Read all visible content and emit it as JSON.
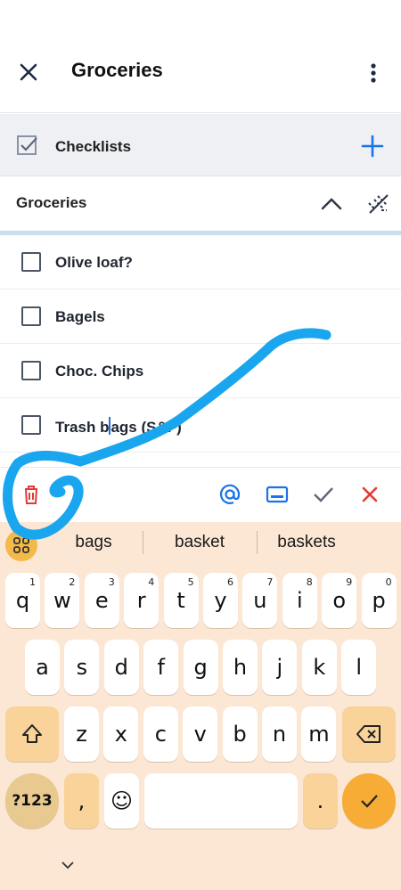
{
  "appbar": {
    "title": "Groceries",
    "close_icon": "close-icon",
    "more_icon": "more-vert-icon"
  },
  "section": {
    "label": "Checklists",
    "icon": "checkbox-checked-icon",
    "add_icon": "plus-icon"
  },
  "list": {
    "name": "Groceries",
    "collapse_icon": "chevron-up-icon",
    "sync_icon": "sync-off-icon",
    "items": [
      {
        "text": "Olive loaf?",
        "checked": false
      },
      {
        "text": "Bagels",
        "checked": false
      },
      {
        "text": "Choc. Chips",
        "checked": false
      },
      {
        "text_before_cursor": "Trash b",
        "text_after_cursor": "ags (S&F)",
        "checked": false
      }
    ]
  },
  "toolbar": {
    "delete_icon": "trash-icon",
    "mention_icon": "at-icon",
    "keyboard_icon": "keyboard-icon",
    "confirm_icon": "check-icon",
    "cancel_icon": "close-icon"
  },
  "keyboard": {
    "suggestions": [
      "bags",
      "basket",
      "baskets"
    ],
    "row1": [
      {
        "k": "q",
        "h": "1"
      },
      {
        "k": "w",
        "h": "2"
      },
      {
        "k": "e",
        "h": "3"
      },
      {
        "k": "r",
        "h": "4"
      },
      {
        "k": "t",
        "h": "5"
      },
      {
        "k": "y",
        "h": "6"
      },
      {
        "k": "u",
        "h": "7"
      },
      {
        "k": "i",
        "h": "8"
      },
      {
        "k": "o",
        "h": "9"
      },
      {
        "k": "p",
        "h": "0"
      }
    ],
    "row2": [
      "a",
      "s",
      "d",
      "f",
      "g",
      "h",
      "j",
      "k",
      "l"
    ],
    "row3": [
      "z",
      "x",
      "c",
      "v",
      "b",
      "n",
      "m"
    ],
    "symbols_label": "?123",
    "comma": ",",
    "emoji": "☺",
    "period": ".",
    "colors": {
      "accent": "#f3b949",
      "background": "#fce7d4",
      "enter": "#f7ac35"
    }
  },
  "colors": {
    "primary_blue": "#1a73e8",
    "delete_red": "#e53935",
    "annotation": "#1aa6ee"
  }
}
